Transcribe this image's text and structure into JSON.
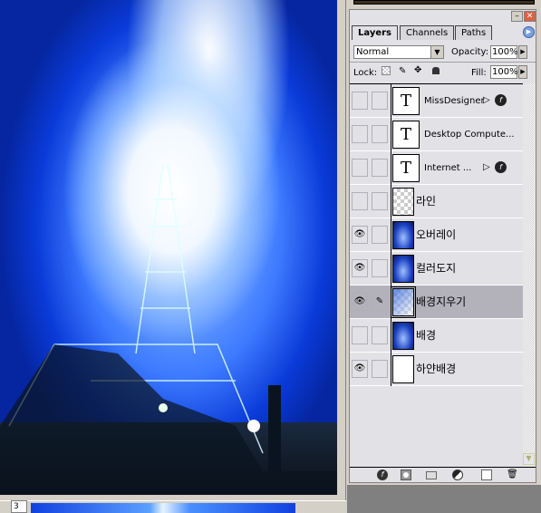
{
  "document": {
    "zoom_field": "3"
  },
  "panel": {
    "tabs": [
      {
        "label": "Layers",
        "active": true
      },
      {
        "label": "Channels"
      },
      {
        "label": "Paths"
      }
    ],
    "blend_mode": "Normal",
    "opacity_label": "Opacity:",
    "opacity_value": "100%",
    "lock_label": "Lock:",
    "fill_label": "Fill:",
    "fill_value": "100%",
    "layers": [
      {
        "name": "MissDesigner",
        "type": "text",
        "visible": false,
        "fx": true
      },
      {
        "name": "Desktop  Compute...",
        "type": "text",
        "visible": false,
        "fx": false
      },
      {
        "name": "Internet     ...",
        "type": "text",
        "visible": false,
        "fx": true
      },
      {
        "name": "라인",
        "type": "transparent",
        "visible": false
      },
      {
        "name": "오버레이",
        "type": "image",
        "visible": true
      },
      {
        "name": "컬러도지",
        "type": "image",
        "visible": true
      },
      {
        "name": "배경지우기",
        "type": "erase",
        "visible": true,
        "selected": true,
        "brush": true
      },
      {
        "name": "배경",
        "type": "image",
        "visible": false
      },
      {
        "name": "하얀배경",
        "type": "white",
        "visible": true
      }
    ],
    "thumb_text_glyph": "T"
  }
}
